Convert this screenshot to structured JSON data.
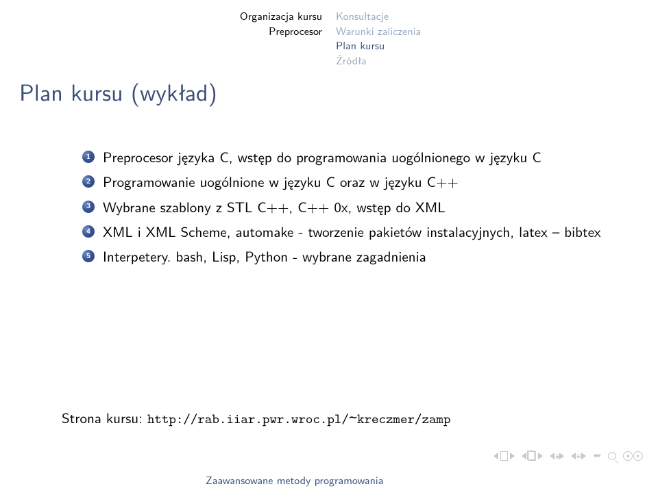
{
  "header": {
    "left": {
      "line1": "Organizacja kursu",
      "line2": "Preprocesor"
    },
    "right": {
      "line1": "Konsultacje",
      "line2": "Warunki zaliczenia",
      "line3_active": "Plan kursu",
      "line4": "Źródła"
    }
  },
  "title": "Plan kursu (wykład)",
  "items": [
    {
      "n": "1",
      "text": "Preprocesor języka C, wstęp do programowania uogólnionego w języku C"
    },
    {
      "n": "2",
      "text": "Programowanie uogólnione w języku C oraz w języku C++"
    },
    {
      "n": "3",
      "text": "Wybrane szablony z STL C++, C++ 0x, wstęp do XML"
    },
    {
      "n": "4",
      "text": "XML i XML Scheme, automake - tworzenie pakietów instalacyjnych, latex – bibtex"
    },
    {
      "n": "5",
      "text": "Interpetery. bash, Lisp, Python - wybrane zagadnienia"
    }
  ],
  "course_label": "Strona kursu: ",
  "course_url_a": "http://rab.iiar.pwr.wroc.pl/",
  "course_url_b": "kreczmer/zamp",
  "footer": "Zaawansowane metody programowania"
}
